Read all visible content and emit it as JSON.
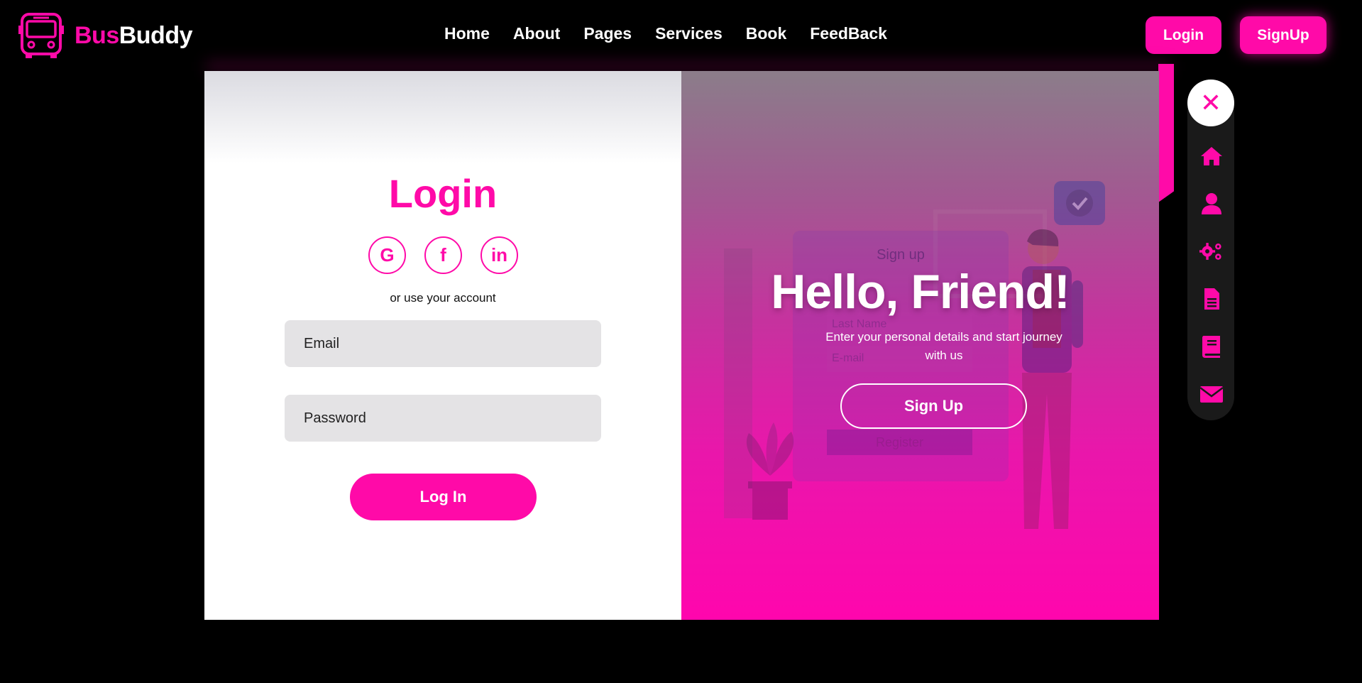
{
  "brand": {
    "part1": "Bus",
    "part2": "Buddy"
  },
  "nav": {
    "links": [
      "Home",
      "About",
      "Pages",
      "Services",
      "Book",
      "FeedBack"
    ],
    "login": "Login",
    "signup": "SignUp"
  },
  "login_form": {
    "title": "Login",
    "socials": [
      {
        "icon": "google-icon",
        "glyph": "G"
      },
      {
        "icon": "facebook-icon",
        "glyph": "f"
      },
      {
        "icon": "linkedin-icon",
        "glyph": "in"
      }
    ],
    "or_text": "or use your account",
    "email_placeholder": "Email",
    "password_placeholder": "Password",
    "submit": "Log In"
  },
  "signup_panel": {
    "title": "Hello, Friend!",
    "subtitle": "Enter your personal details and start journey with us",
    "button": "Sign Up",
    "ghost_card": {
      "heading": "Sign up",
      "fields": [
        "Last Name",
        "E-mail"
      ],
      "button": "Register"
    }
  },
  "side_menu": {
    "items": [
      "close-icon",
      "home-icon",
      "user-icon",
      "gears-icon",
      "document-icon",
      "book-icon",
      "envelope-icon"
    ]
  },
  "colors": {
    "accent": "#ff0aa8",
    "background": "#000000"
  }
}
